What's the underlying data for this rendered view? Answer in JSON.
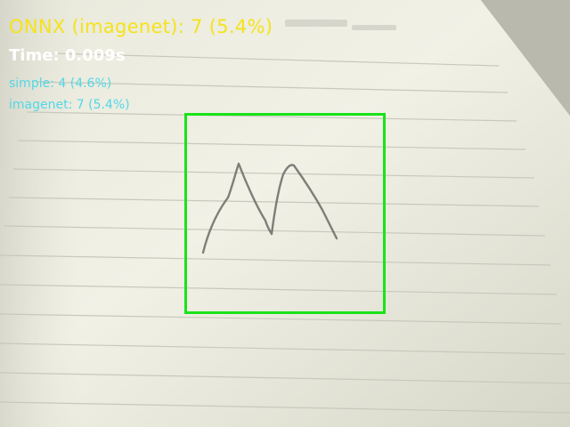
{
  "overlay": {
    "headline": "ONNX (imagenet): 7 (5.4%)",
    "timing": "Time: 0.009s",
    "scores": [
      {
        "label": "simple: 4 (4.6%)"
      },
      {
        "label": "imagenet: 7 (5.4%)"
      }
    ]
  },
  "colors": {
    "headline": "#f5e31a",
    "timing": "#ffffff",
    "scores": "#52d8e6",
    "roi_box": "#19e319",
    "pencil": "#6b6b66"
  },
  "scene": {
    "subject": "camera view of a ruled notebook page with a pencil-drawn digit inside a detection box"
  }
}
